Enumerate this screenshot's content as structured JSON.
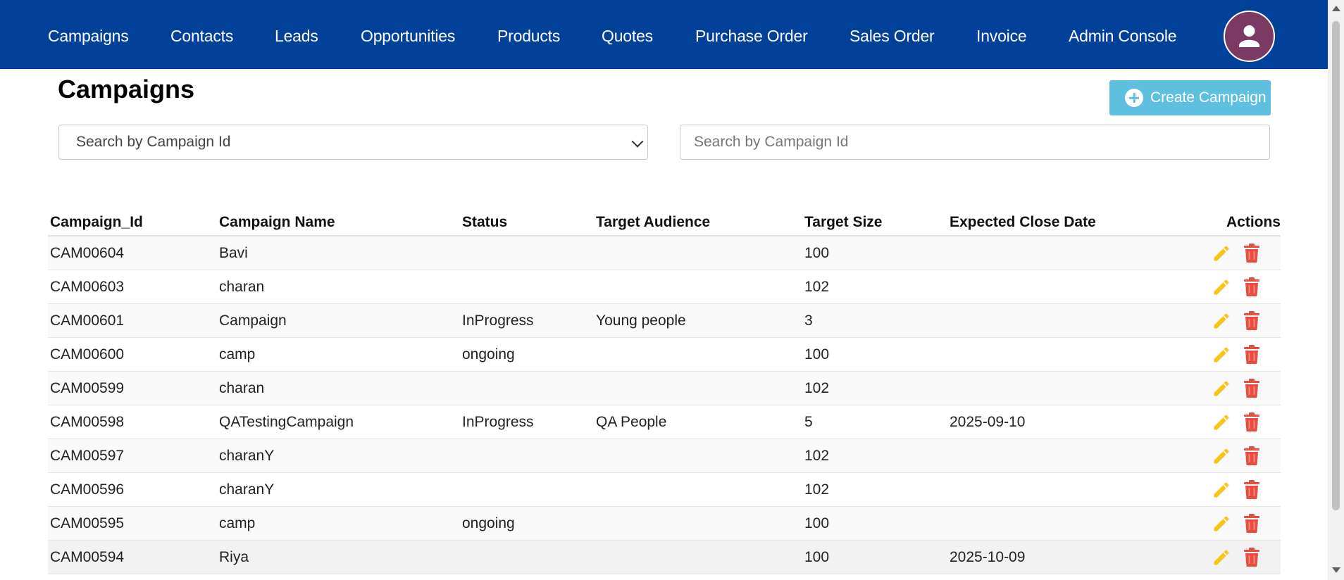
{
  "nav": {
    "items": [
      "Campaigns",
      "Contacts",
      "Leads",
      "Opportunities",
      "Products",
      "Quotes",
      "Purchase Order",
      "Sales Order",
      "Invoice",
      "Admin Console"
    ],
    "avatar_icon": "user-icon"
  },
  "page": {
    "title": "Campaigns",
    "create_button_label": "Create Campaign",
    "create_icon": "plus-circle-icon"
  },
  "filters": {
    "select_value": "Search by Campaign Id",
    "search_placeholder": "Search by Campaign Id"
  },
  "table": {
    "columns": [
      "Campaign_Id",
      "Campaign Name",
      "Status",
      "Target Audience",
      "Target Size",
      "Expected Close Date",
      "Actions"
    ],
    "rows": [
      [
        "CAM00604",
        "Bavi",
        "",
        "",
        "100",
        ""
      ],
      [
        "CAM00603",
        "charan",
        "",
        "",
        "102",
        ""
      ],
      [
        "CAM00601",
        "Campaign",
        "InProgress",
        "Young people",
        "3",
        ""
      ],
      [
        "CAM00600",
        "camp",
        "ongoing",
        "",
        "100",
        ""
      ],
      [
        "CAM00599",
        "charan",
        "",
        "",
        "102",
        ""
      ],
      [
        "CAM00598",
        "QATestingCampaign",
        "InProgress",
        "QA People",
        "5",
        "2025-09-10"
      ],
      [
        "CAM00597",
        "charanY",
        "",
        "",
        "102",
        ""
      ],
      [
        "CAM00596",
        "charanY",
        "",
        "",
        "102",
        ""
      ],
      [
        "CAM00595",
        "camp",
        "ongoing",
        "",
        "100",
        ""
      ],
      [
        "CAM00594",
        "Riya",
        "",
        "",
        "100",
        "2025-10-09"
      ]
    ],
    "edit_icon": "pencil-icon",
    "delete_icon": "trash-icon"
  },
  "colors": {
    "navbar": "#02419a",
    "create_button": "#5ec0de",
    "edit_icon": "#f5c518",
    "delete_icon": "#e74c3c",
    "avatar": "#7b3a63"
  }
}
